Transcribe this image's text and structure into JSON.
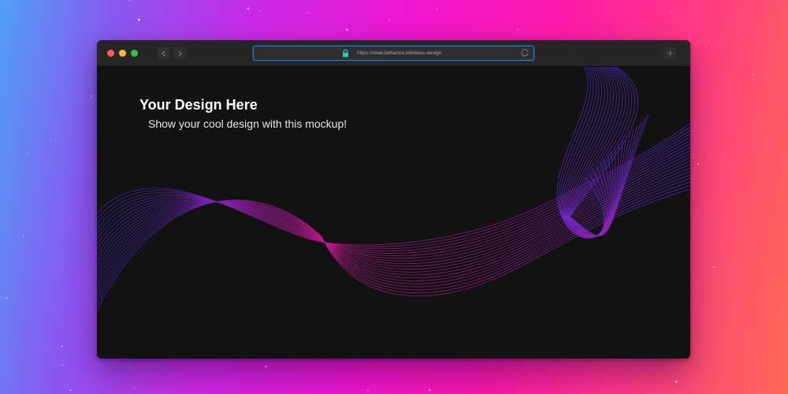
{
  "browser": {
    "url": "https://www.behance.net/elias-design",
    "icons": {
      "close": "close-dot-icon",
      "minimize": "minimize-dot-icon",
      "zoom": "zoom-dot-icon",
      "back": "chevron-left-icon",
      "forward": "chevron-right-icon",
      "lock": "lock-icon",
      "reload": "reload-icon",
      "new_tab": "plus-icon"
    },
    "colors": {
      "close": "#fe5f57",
      "minimize": "#febc2e",
      "zoom": "#28c840",
      "address_border": "#1f7fd6",
      "lock": "#25d2b0"
    }
  },
  "page": {
    "headline": "Your Design Here",
    "subline": "Show your cool design with this mockup!",
    "colors": {
      "background": "#121212",
      "wave_start": "#3c2ad8",
      "wave_mid": "#c0178a",
      "wave_end": "#6a2cff"
    }
  },
  "backdrop": {
    "colors": [
      "#4fa0f5",
      "#c92ae6",
      "#ee16d0",
      "#fc1aa8",
      "#ff6a55"
    ]
  }
}
